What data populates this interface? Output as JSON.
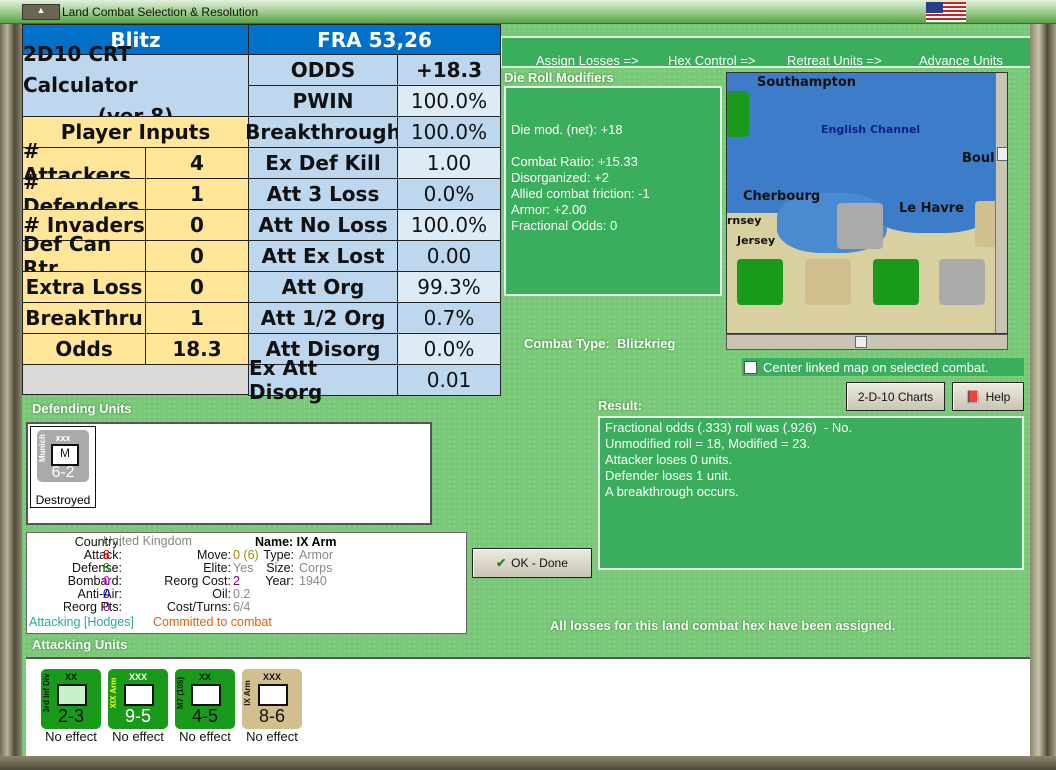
{
  "window": {
    "title": "Land Combat Selection & Resolution"
  },
  "steps": [
    "Assign Losses =>",
    "Hex Control =>",
    "Retreat Units =>",
    "Advance Units"
  ],
  "crt": {
    "header_left": "Blitz",
    "header_right": "FRA 53,26",
    "calc_title_1": "2D10 CRT Calculator",
    "calc_title_2": "(ver 8)",
    "player_inputs": "Player Inputs",
    "inputs": [
      {
        "label": "# Attackers",
        "value": "4"
      },
      {
        "label": "# Defenders",
        "value": "1"
      },
      {
        "label": "# Invaders",
        "value": "0"
      },
      {
        "label": "Def Can Rtr",
        "value": "0"
      },
      {
        "label": "Extra Loss",
        "value": "0"
      },
      {
        "label": "BreakThru",
        "value": "1"
      },
      {
        "label": "Odds",
        "value": "18.3"
      }
    ],
    "results": [
      {
        "label": "ODDS",
        "value": "+18.3"
      },
      {
        "label": "PWIN",
        "value": "100.0%"
      },
      {
        "label": "Breakthrough",
        "value": "100.0%"
      },
      {
        "label": "Ex Def Kill",
        "value": "1.00"
      },
      {
        "label": "Att 3 Loss",
        "value": "0.0%"
      },
      {
        "label": "Att No Loss",
        "value": "100.0%"
      },
      {
        "label": "Att Ex Lost",
        "value": "0.00"
      },
      {
        "label": "Att Org",
        "value": "99.3%"
      },
      {
        "label": "Att 1/2 Org",
        "value": "0.7%"
      },
      {
        "label": "Att Disorg",
        "value": "0.0%"
      },
      {
        "label": "Ex Att Disorg",
        "value": "0.01"
      }
    ]
  },
  "die_roll": {
    "title": "Die Roll Modifiers",
    "lines": [
      "Die mod. (net): +18",
      "",
      "Combat Ratio: +15.33",
      "Disorganized: +2",
      "Allied combat friction: -1",
      "Armor: +2.00",
      "Fractional Odds: 0"
    ]
  },
  "combat_type": {
    "label": "Combat Type:",
    "value": "Blitzkrieg"
  },
  "map": {
    "labels": [
      "Southampton",
      "English Channel",
      "Boulo",
      "Cherbourg",
      "Le Havre",
      "rnsey",
      "Jersey"
    ]
  },
  "center_map": {
    "label": "Center linked map on selected combat.",
    "checked": false
  },
  "buttons": {
    "charts": "2-D-10 Charts",
    "help": "Help",
    "ok": "OK - Done"
  },
  "result": {
    "title": "Result:",
    "lines": [
      "Fractional odds (.333) roll was (.926)  - No.",
      "Unmodified roll = 18, Modified = 23.",
      "Attacker loses 0 units.",
      "Defender loses 1 unit.",
      "A breakthrough occurs."
    ]
  },
  "defending": {
    "title": "Defending Units",
    "units": [
      {
        "name": "Munich",
        "size": "xxx",
        "symbol": "M",
        "strength": "6-2",
        "status": "Destroyed"
      }
    ]
  },
  "info": {
    "country_k": "Country:",
    "country": "United Kingdom",
    "attack_k": "Attack:",
    "attack": "8",
    "defense_k": "Defense:",
    "defense": "8",
    "bombard_k": "Bombard:",
    "bombard": "0",
    "antiair_k": "Anti-Air:",
    "antiair": "0",
    "reorgpts_k": "Reorg Pts:",
    "reorgpts": "0",
    "move_k": "Move:",
    "move": "0 (6)",
    "elite_k": "Elite:",
    "elite": "Yes",
    "reorgcost_k": "Reorg Cost:",
    "reorgcost": "2",
    "oil_k": "Oil:",
    "oil": "0.2",
    "cost_k": "Cost/Turns:",
    "cost": "6/4",
    "name": "Name: IX Arm",
    "type_k": "Type:",
    "type": "Armor",
    "size_k": "Size:",
    "size": "Corps",
    "year_k": "Year:",
    "year": "1940",
    "attacking": "Attacking [Hodges]",
    "committed": "Committed to combat"
  },
  "all_losses": "All losses for this land combat hex have been assigned.",
  "attacking": {
    "title": "Attacking Units",
    "units": [
      {
        "name": "3rd Inf Div",
        "size": "XX",
        "strength": "2-3",
        "status": "No effect",
        "color": "#1a9a1a"
      },
      {
        "name": "XIX Arm",
        "size": "XXX",
        "strength": "9-5",
        "status": "No effect",
        "color": "#1a9a1a"
      },
      {
        "name": "M7 (105)",
        "size": "XX",
        "strength": "4-5",
        "status": "No effect",
        "color": "#1a9a1a"
      },
      {
        "name": "IX Arm",
        "size": "XXX",
        "strength": "8-6",
        "status": "No effect",
        "color": "#d2bf8e"
      }
    ]
  }
}
